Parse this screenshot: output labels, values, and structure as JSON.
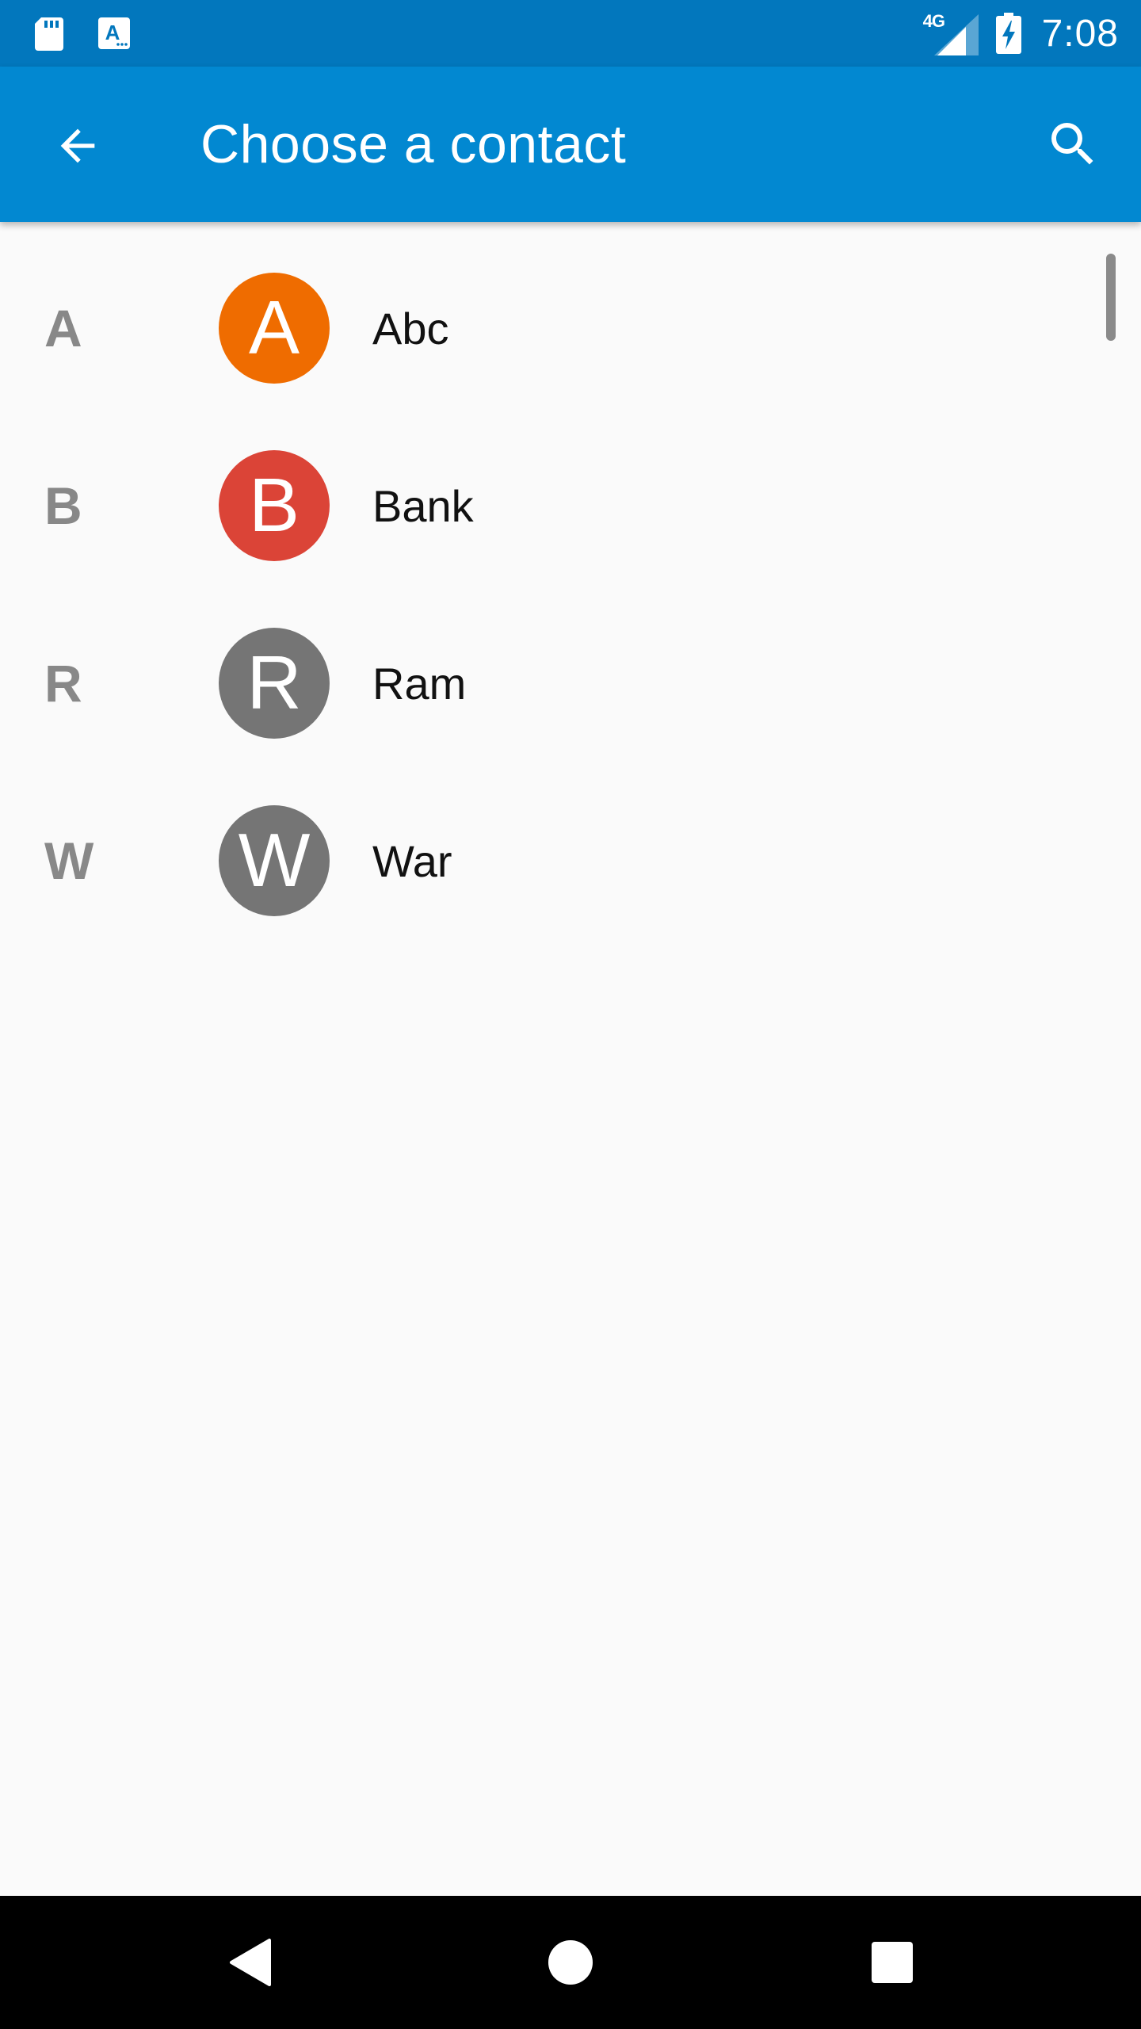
{
  "status_bar": {
    "network_label": "4G",
    "time": "7:08",
    "icons": [
      "sd-card-icon",
      "text-badge-icon",
      "signal-icon",
      "battery-charging-icon"
    ]
  },
  "app_bar": {
    "title": "Choose a contact",
    "back_icon": "arrow-back-icon",
    "search_icon": "search-icon"
  },
  "contacts": [
    {
      "section": "A",
      "initial": "A",
      "name": "Abc",
      "avatar_color": "#ef6c00"
    },
    {
      "section": "B",
      "initial": "B",
      "name": "Bank",
      "avatar_color": "#db4437"
    },
    {
      "section": "R",
      "initial": "R",
      "name": "Ram",
      "avatar_color": "#757575"
    },
    {
      "section": "W",
      "initial": "W",
      "name": "War",
      "avatar_color": "#757575"
    }
  ],
  "colors": {
    "status_bar": "#0277bd",
    "app_bar": "#0288d1",
    "background": "#fafafa",
    "section_letter": "#888888"
  },
  "nav_bar": {
    "icons": [
      "nav-back-icon",
      "nav-home-icon",
      "nav-recents-icon"
    ]
  }
}
